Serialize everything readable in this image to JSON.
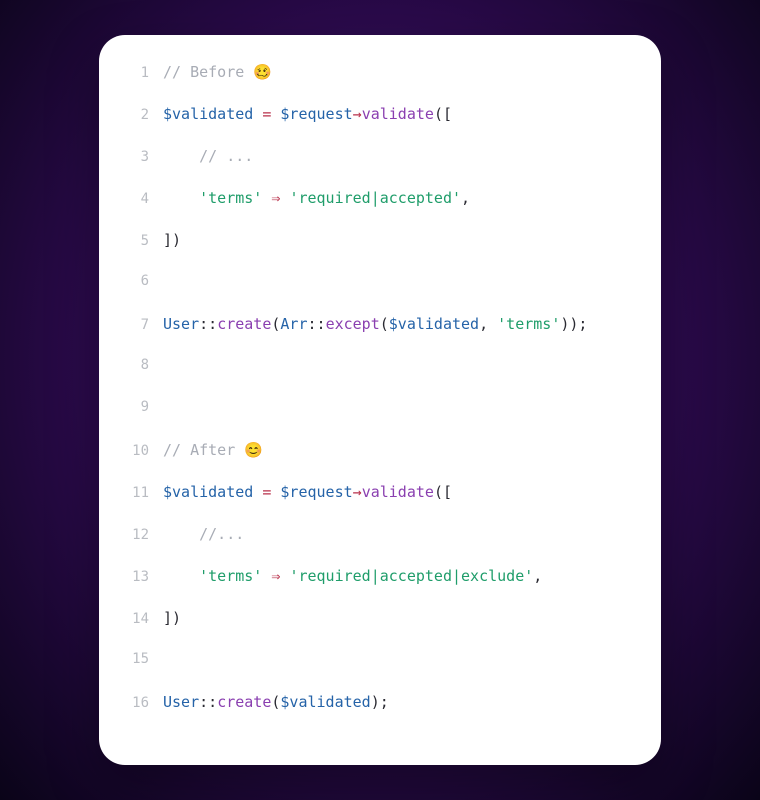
{
  "code": {
    "lines": [
      {
        "num": "1",
        "tokens": [
          {
            "cls": "tok-comment",
            "text": "// Before "
          },
          {
            "cls": "tok-comment emoji",
            "text": "🥴"
          }
        ]
      },
      {
        "num": "2",
        "tokens": [
          {
            "cls": "tok-var",
            "text": "$validated"
          },
          {
            "cls": "tok-punct",
            "text": " "
          },
          {
            "cls": "tok-op",
            "text": "="
          },
          {
            "cls": "tok-punct",
            "text": " "
          },
          {
            "cls": "tok-var",
            "text": "$request"
          },
          {
            "cls": "tok-op",
            "text": "→"
          },
          {
            "cls": "tok-method",
            "text": "validate"
          },
          {
            "cls": "tok-punct",
            "text": "(["
          }
        ]
      },
      {
        "num": "3",
        "tokens": [
          {
            "cls": "tok-punct",
            "text": "    "
          },
          {
            "cls": "tok-comment",
            "text": "// ..."
          }
        ]
      },
      {
        "num": "4",
        "tokens": [
          {
            "cls": "tok-punct",
            "text": "    "
          },
          {
            "cls": "tok-string",
            "text": "'terms'"
          },
          {
            "cls": "tok-punct",
            "text": " "
          },
          {
            "cls": "tok-op",
            "text": "⇒"
          },
          {
            "cls": "tok-punct",
            "text": " "
          },
          {
            "cls": "tok-string",
            "text": "'required|accepted'"
          },
          {
            "cls": "tok-punct",
            "text": ","
          }
        ]
      },
      {
        "num": "5",
        "tokens": [
          {
            "cls": "tok-punct",
            "text": "])"
          }
        ]
      },
      {
        "num": "6",
        "tokens": []
      },
      {
        "num": "7",
        "tokens": [
          {
            "cls": "tok-class",
            "text": "User"
          },
          {
            "cls": "tok-punct",
            "text": "::"
          },
          {
            "cls": "tok-static",
            "text": "create"
          },
          {
            "cls": "tok-punct",
            "text": "("
          },
          {
            "cls": "tok-class",
            "text": "Arr"
          },
          {
            "cls": "tok-punct",
            "text": "::"
          },
          {
            "cls": "tok-static",
            "text": "except"
          },
          {
            "cls": "tok-punct",
            "text": "("
          },
          {
            "cls": "tok-var",
            "text": "$validated"
          },
          {
            "cls": "tok-punct",
            "text": ", "
          },
          {
            "cls": "tok-string",
            "text": "'terms'"
          },
          {
            "cls": "tok-punct",
            "text": "));"
          }
        ]
      },
      {
        "num": "8",
        "tokens": []
      },
      {
        "num": "9",
        "tokens": []
      },
      {
        "num": "10",
        "tokens": [
          {
            "cls": "tok-comment",
            "text": "// After "
          },
          {
            "cls": "tok-comment emoji",
            "text": "😊"
          }
        ]
      },
      {
        "num": "11",
        "tokens": [
          {
            "cls": "tok-var",
            "text": "$validated"
          },
          {
            "cls": "tok-punct",
            "text": " "
          },
          {
            "cls": "tok-op",
            "text": "="
          },
          {
            "cls": "tok-punct",
            "text": " "
          },
          {
            "cls": "tok-var",
            "text": "$request"
          },
          {
            "cls": "tok-op",
            "text": "→"
          },
          {
            "cls": "tok-method",
            "text": "validate"
          },
          {
            "cls": "tok-punct",
            "text": "(["
          }
        ]
      },
      {
        "num": "12",
        "tokens": [
          {
            "cls": "tok-punct",
            "text": "    "
          },
          {
            "cls": "tok-comment",
            "text": "//..."
          }
        ]
      },
      {
        "num": "13",
        "tokens": [
          {
            "cls": "tok-punct",
            "text": "    "
          },
          {
            "cls": "tok-string",
            "text": "'terms'"
          },
          {
            "cls": "tok-punct",
            "text": " "
          },
          {
            "cls": "tok-op",
            "text": "⇒"
          },
          {
            "cls": "tok-punct",
            "text": " "
          },
          {
            "cls": "tok-string",
            "text": "'required|accepted|exclude'"
          },
          {
            "cls": "tok-punct",
            "text": ","
          }
        ]
      },
      {
        "num": "14",
        "tokens": [
          {
            "cls": "tok-punct",
            "text": "])"
          }
        ]
      },
      {
        "num": "15",
        "tokens": []
      },
      {
        "num": "16",
        "tokens": [
          {
            "cls": "tok-class",
            "text": "User"
          },
          {
            "cls": "tok-punct",
            "text": "::"
          },
          {
            "cls": "tok-static",
            "text": "create"
          },
          {
            "cls": "tok-punct",
            "text": "("
          },
          {
            "cls": "tok-var",
            "text": "$validated"
          },
          {
            "cls": "tok-punct",
            "text": ");"
          }
        ]
      }
    ]
  }
}
